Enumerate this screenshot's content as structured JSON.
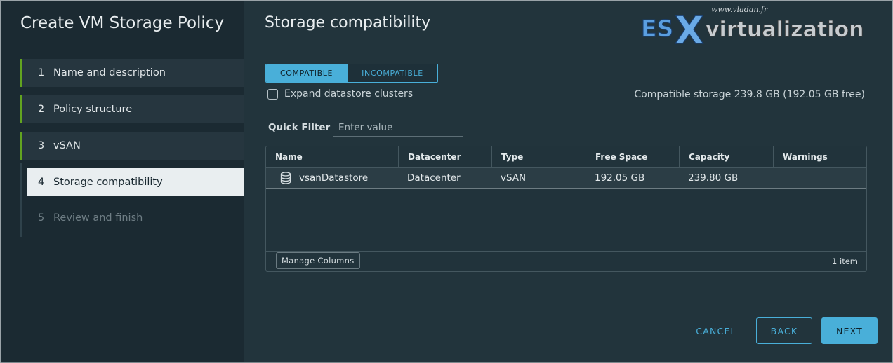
{
  "wizard": {
    "title": "Create VM Storage Policy",
    "steps": [
      {
        "number": "1",
        "label": "Name and description",
        "state": "done"
      },
      {
        "number": "2",
        "label": "Policy structure",
        "state": "done"
      },
      {
        "number": "3",
        "label": "vSAN",
        "state": "done"
      },
      {
        "number": "4",
        "label": "Storage compatibility",
        "state": "active"
      },
      {
        "number": "5",
        "label": "Review and finish",
        "state": "disabled"
      }
    ]
  },
  "watermark": {
    "site": "www.vladan.fr",
    "brand_es": "ES",
    "brand_x": "X",
    "brand_rest": "virtualization"
  },
  "page": {
    "title": "Storage compatibility",
    "toggle": {
      "compatible": "COMPATIBLE",
      "incompatible": "INCOMPATIBLE",
      "selected": "COMPATIBLE"
    },
    "expand_label": "Expand datastore clusters",
    "compatible_summary": "Compatible storage 239.8 GB (192.05 GB free)",
    "quick_filter": {
      "label": "Quick Filter",
      "placeholder": "Enter value"
    }
  },
  "grid": {
    "columns": [
      "Name",
      "Datacenter",
      "Type",
      "Free Space",
      "Capacity",
      "Warnings"
    ],
    "rows": [
      {
        "name": "vsanDatastore",
        "datacenter": "Datacenter",
        "type": "vSAN",
        "free_space": "192.05 GB",
        "capacity": "239.80 GB",
        "warnings": ""
      }
    ],
    "manage_columns": "Manage Columns",
    "item_count": "1 item"
  },
  "footer": {
    "cancel": "CANCEL",
    "back": "BACK",
    "next": "NEXT"
  },
  "colors": {
    "accent": "#49afd9",
    "done_marker": "#62a420",
    "background": "#22343c"
  }
}
